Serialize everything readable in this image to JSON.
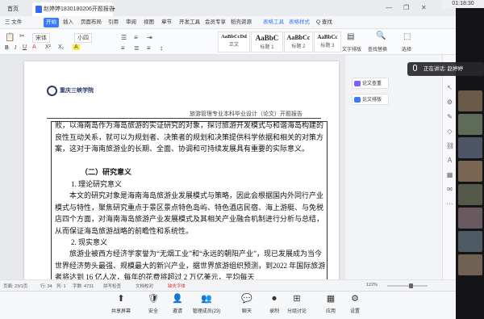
{
  "window": {
    "home_label": "首页",
    "doc_tab_title": "赵婷婷18301802​06开题报告",
    "new_tab_symbol": "+",
    "clock": "01:18:30"
  },
  "menu": {
    "file": "三 文件",
    "items": [
      "开始",
      "插入",
      "页面布局",
      "引用",
      "审阅",
      "视图",
      "章节",
      "开发工具",
      "会员专享",
      "稻壳资源"
    ],
    "active_index": 0,
    "table_tools": "表格工具",
    "table_style": "表格样式",
    "search_label": "Q 查找"
  },
  "toolbar": {
    "font_name": "宋体",
    "font_size": "小四",
    "styles": [
      {
        "preview": "AaBbCcDd",
        "label": "正文"
      },
      {
        "preview": "AaBbC",
        "label": "标题 1"
      },
      {
        "preview": "AaBbCc",
        "label": "标题 2"
      },
      {
        "preview": "AaBbCc",
        "label": "标题 3"
      }
    ],
    "text_layout": "文字排版",
    "find_replace": "查找替换",
    "select": "选择"
  },
  "document": {
    "logo_text": "重庆三峡学院",
    "header": "旅游管理专业本科毕业设计（论文）开题报告",
    "para1": "败，以海南岛作为海岛旅游的实证研究的对象，探讨旅游开发模式与和谐海岛构建的良性互动关系，就可以为规划者、决策者的规划和决策提供科学依据和相关的对策方案，这对于海南旅游业的长期、全面、协调和可持续发展具有重要的实际意义。",
    "heading_research": "（二）研究意义",
    "heading_theory": "1. 理论研究意义",
    "para2": "本文的研究对象是海南海岛旅游业发展模式与策略，因此会根据国内外同行产业模式与特性，聚焦研究重点于景区景点特色岛屿、特色酒店民宿、海上游艇、与免税店四个方面，对海南海岛旅游产业发展模式及其相关产业融合机制进行分析与总结，从而保证海岛旅游战略的前瞻性和系统性。",
    "heading_practice": "2. 现实意义",
    "para3": "旅游业被西方经济学家誉为“无烟工业”和“永远的朝阳产业”，现已发展成为当今世界经济势头最强、规模最大的新兴产业，据世界旅游组织预测，到2022 年国际旅游者将达到 16 亿人次，每年的花费将超过 2 万亿美元，平均每天"
  },
  "side_panel": {
    "buttons": [
      "论文查重",
      "论文排版"
    ]
  },
  "status": {
    "page": "页面: 23/1页",
    "line": "行: 34",
    "col": "列: 1",
    "words": "字数: 4731",
    "spell": "拼写检查",
    "proof": "文档校对",
    "missing_font": "缺失字体",
    "zoom": "122%",
    "zoom_fraction": 0.6
  },
  "meeting": {
    "buttons": [
      {
        "icon": "share-screen-icon",
        "label": "共享屏幕"
      },
      {
        "icon": "shield-icon",
        "label": "安全"
      },
      {
        "icon": "invite-icon",
        "label": "邀请"
      },
      {
        "icon": "members-icon",
        "label": "管理成员(23)"
      },
      {
        "icon": "chat-icon",
        "label": "聊天"
      },
      {
        "icon": "record-icon",
        "label": "录制"
      },
      {
        "icon": "breakout-icon",
        "label": "分组讨论"
      },
      {
        "icon": "apps-icon",
        "label": "应用"
      },
      {
        "icon": "settings-icon",
        "label": "设置"
      }
    ]
  },
  "speaker": {
    "text": "正在讲话: 赵婷婷"
  }
}
